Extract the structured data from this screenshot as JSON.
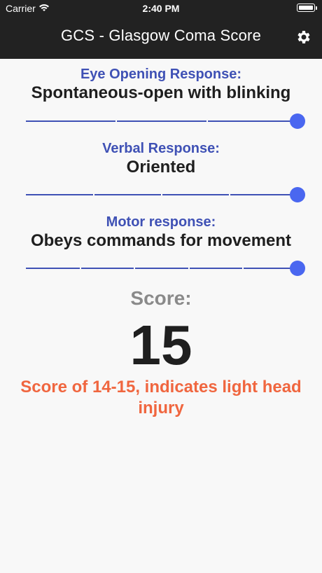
{
  "status_bar": {
    "carrier": "Carrier",
    "time": "2:40 PM",
    "wifi_icon": "wifi-icon",
    "battery_icon": "battery-icon"
  },
  "header": {
    "title": "GCS - Glasgow Coma Score",
    "settings_icon": "gear-icon",
    "background": "#222222"
  },
  "criteria": [
    {
      "label": "Eye Opening Response:",
      "value": "Spontaneous-open with blinking",
      "level": 4,
      "max": 4
    },
    {
      "label": "Verbal Response:",
      "value": "Oriented",
      "level": 5,
      "max": 5
    },
    {
      "label": "Motor response:",
      "value": "Obeys commands for movement",
      "level": 6,
      "max": 6
    }
  ],
  "score": {
    "label": "Score:",
    "value": "15",
    "interpretation": "Score of 14-15, indicates light head injury"
  },
  "colors": {
    "label_color": "#3f51b5",
    "slider_thumb": "#4a67f0",
    "interpretation": "#f0663f",
    "score_label": "#8a8a8a"
  }
}
